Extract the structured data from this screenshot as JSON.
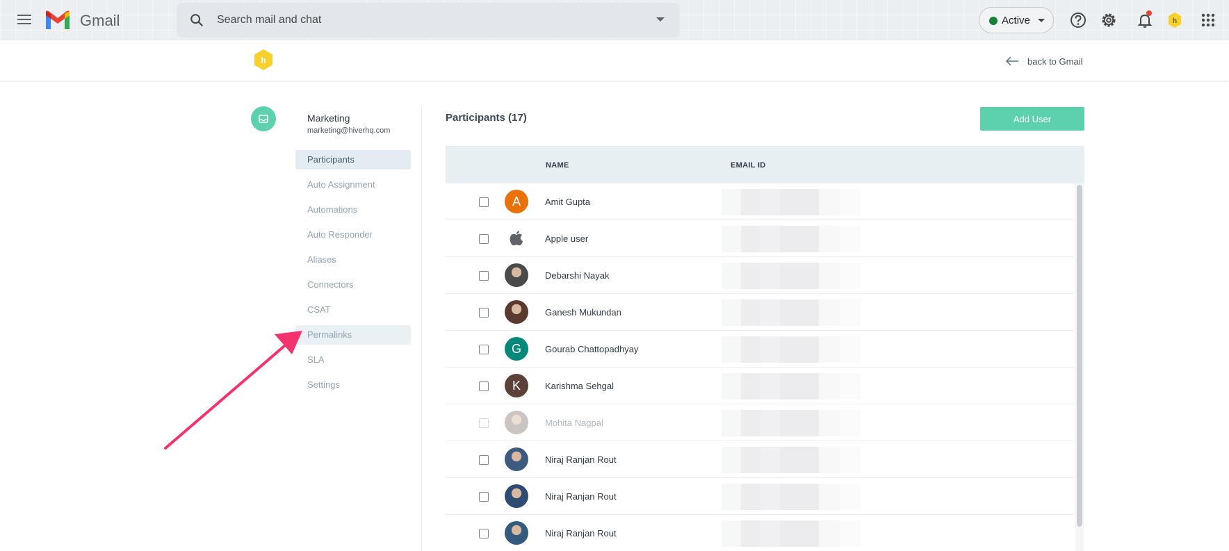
{
  "gmail": {
    "title": "Gmail",
    "search_placeholder": "Search mail and chat",
    "status": "Active"
  },
  "hiver": {
    "back_label": "back to Gmail"
  },
  "group": {
    "name": "Marketing",
    "email": "marketing@hiverhq.com"
  },
  "nav": [
    {
      "label": "Participants",
      "state": "active"
    },
    {
      "label": "Auto Assignment",
      "state": ""
    },
    {
      "label": "Automations",
      "state": ""
    },
    {
      "label": "Auto Responder",
      "state": ""
    },
    {
      "label": "Aliases",
      "state": ""
    },
    {
      "label": "Connectors",
      "state": ""
    },
    {
      "label": "CSAT",
      "state": ""
    },
    {
      "label": "Permalinks",
      "state": "hover"
    },
    {
      "label": "SLA",
      "state": ""
    },
    {
      "label": "Settings",
      "state": ""
    }
  ],
  "participants": {
    "title": "Participants (17)",
    "add_button": "Add User",
    "columns": [
      "NAME",
      "EMAIL ID"
    ],
    "rows": [
      {
        "name": "Amit Gupta",
        "avatar": "A",
        "avatar_color": "#e8710a",
        "dim": false
      },
      {
        "name": "Apple user",
        "avatar": "apple-icon",
        "avatar_color": "#ffffff",
        "dim": false
      },
      {
        "name": "Debarshi Nayak",
        "avatar": "photo",
        "avatar_color": "#4a4a4a",
        "dim": false
      },
      {
        "name": "Ganesh Mukundan",
        "avatar": "photo",
        "avatar_color": "#5b3a2e",
        "dim": false
      },
      {
        "name": "Gourab Chattopadhyay",
        "avatar": "G",
        "avatar_color": "#00897b",
        "dim": false
      },
      {
        "name": "Karishma Sehgal",
        "avatar": "K",
        "avatar_color": "#5d4037",
        "dim": false
      },
      {
        "name": "Mohita Nagpal",
        "avatar": "photo",
        "avatar_color": "#8d7b75",
        "dim": true
      },
      {
        "name": "Niraj Ranjan Rout",
        "avatar": "photo",
        "avatar_color": "#3d5a80",
        "dim": false
      },
      {
        "name": "Niraj Ranjan Rout",
        "avatar": "photo",
        "avatar_color": "#2d4b73",
        "dim": false
      },
      {
        "name": "Niraj Ranjan Rout",
        "avatar": "photo",
        "avatar_color": "#345a7d",
        "dim": false
      }
    ]
  },
  "colors": {
    "accent_green": "#5dd1ad",
    "annotation_arrow": "#f4336e",
    "hiver_yellow": "#f7d02c"
  }
}
